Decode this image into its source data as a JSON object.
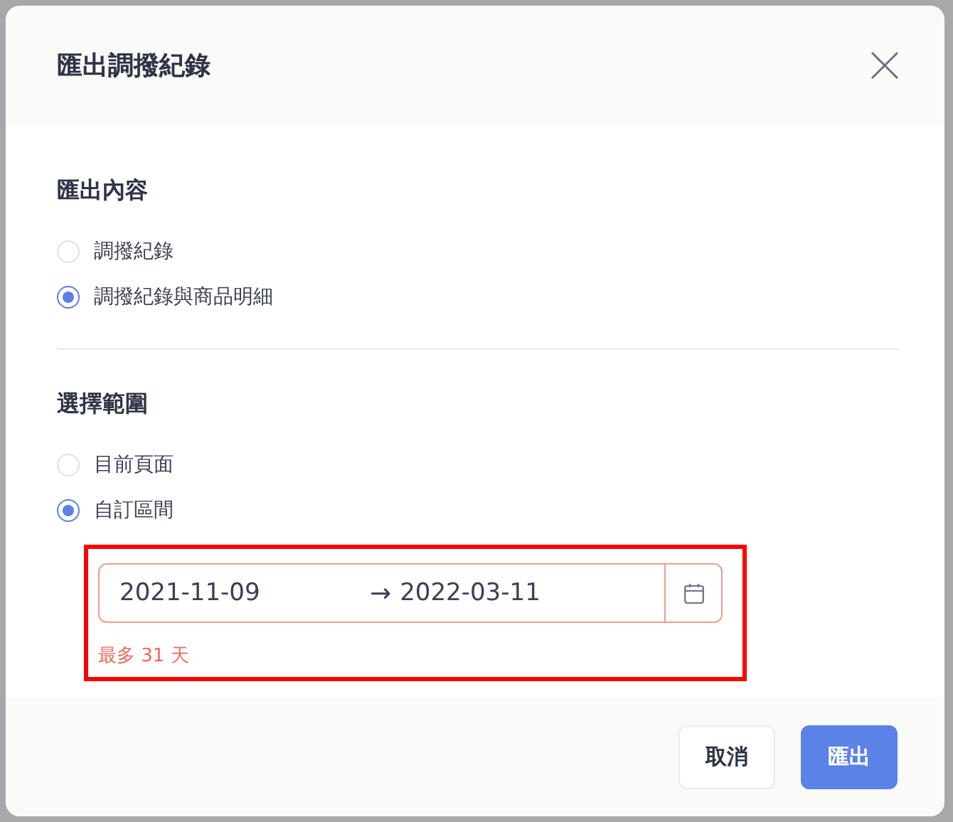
{
  "dialog": {
    "title": "匯出調撥紀錄",
    "sections": [
      {
        "title": "匯出內容",
        "options": [
          {
            "label": "調撥紀錄",
            "selected": false
          },
          {
            "label": "調撥紀錄與商品明細",
            "selected": true
          }
        ]
      },
      {
        "title": "選擇範圍",
        "options": [
          {
            "label": "目前頁面",
            "selected": false
          },
          {
            "label": "自訂區間",
            "selected": true
          }
        ]
      }
    ],
    "date_range": {
      "start": "2021-11-09",
      "arrow": "→",
      "end": "2022-03-11",
      "error": "最多 31 天",
      "invalid": true,
      "highlighted": true
    },
    "buttons": [
      {
        "label": "取消",
        "kind": "secondary"
      },
      {
        "label": "匯出",
        "kind": "primary"
      }
    ]
  }
}
